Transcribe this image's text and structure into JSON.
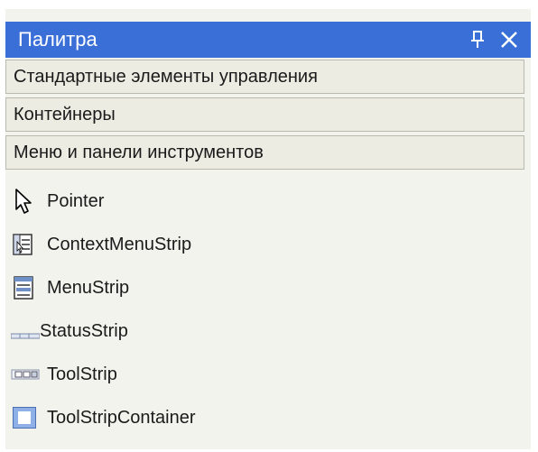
{
  "palette": {
    "title": "Палитра",
    "pin_icon": "pin-icon",
    "close_icon": "close-icon",
    "accent_color": "#3a6fd8"
  },
  "categories": [
    {
      "label": "Стандартные элементы управления"
    },
    {
      "label": "Контейнеры"
    },
    {
      "label": "Меню и панели инструментов"
    }
  ],
  "tools": [
    {
      "label": "Pointer",
      "icon": "pointer-icon"
    },
    {
      "label": "ContextMenuStrip",
      "icon": "context-menu-strip-icon"
    },
    {
      "label": "MenuStrip",
      "icon": "menu-strip-icon"
    },
    {
      "label": "StatusStrip",
      "icon": "status-strip-icon"
    },
    {
      "label": "ToolStrip",
      "icon": "tool-strip-icon"
    },
    {
      "label": "ToolStripContainer",
      "icon": "tool-strip-container-icon"
    }
  ]
}
